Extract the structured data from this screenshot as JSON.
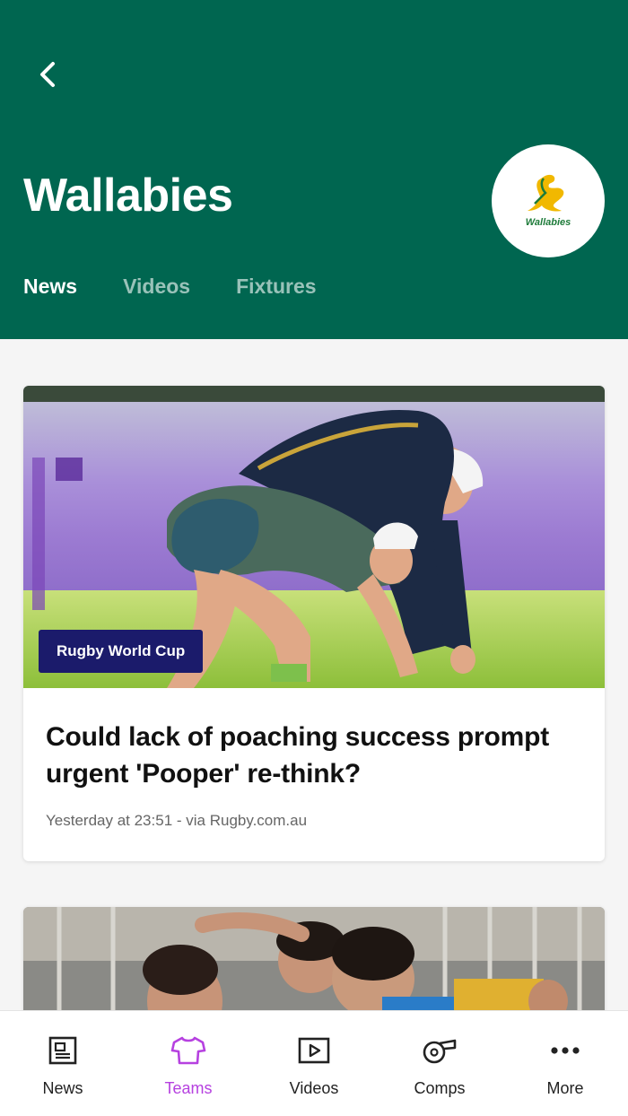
{
  "header": {
    "title": "Wallabies",
    "logo_text": "Wallabies",
    "tabs": [
      {
        "label": "News"
      },
      {
        "label": "Videos"
      },
      {
        "label": "Fixtures"
      }
    ]
  },
  "articles": [
    {
      "badge": "Rugby World Cup",
      "headline": "Could lack of poaching success prompt urgent 'Pooper' re-think?",
      "meta": "Yesterday at 23:51 - via Rugby.com.au"
    }
  ],
  "bottom_nav": [
    {
      "label": "News",
      "icon": "newspaper-icon"
    },
    {
      "label": "Teams",
      "icon": "jersey-icon"
    },
    {
      "label": "Videos",
      "icon": "play-icon"
    },
    {
      "label": "Comps",
      "icon": "whistle-icon"
    },
    {
      "label": "More",
      "icon": "more-icon"
    }
  ],
  "colors": {
    "header_bg": "#006650",
    "active_nav": "#b641e0",
    "badge_bg": "#1b1b6b",
    "logo_gold": "#f1b800"
  }
}
